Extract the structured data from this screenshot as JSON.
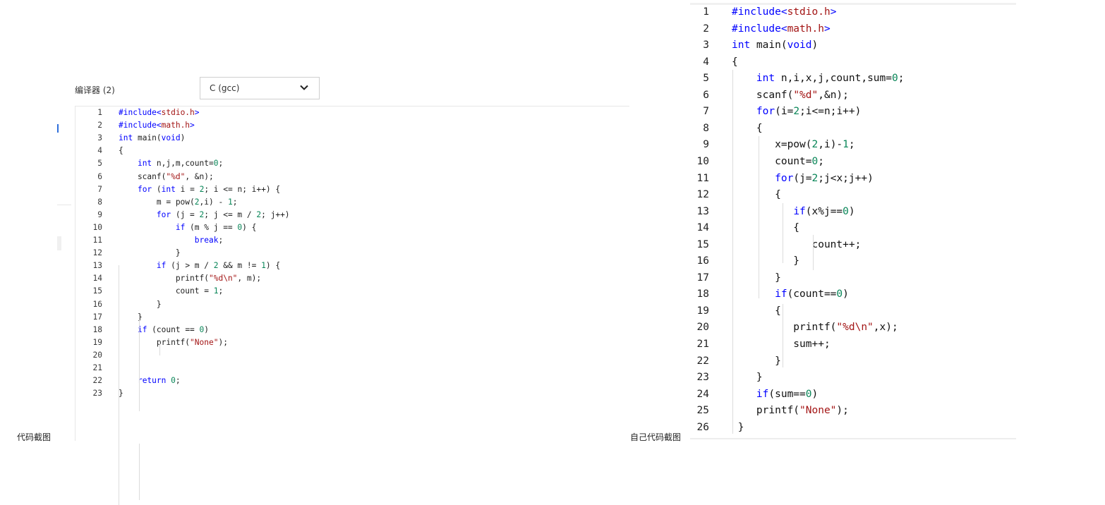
{
  "left": {
    "compiler_label": "编译器 (2)",
    "compiler_value": "C (gcc)",
    "caption": "代码截图",
    "lines": [
      [
        [
          "p",
          "#include<"
        ],
        [
          "hdr",
          "stdio.h"
        ],
        [
          "p",
          ">"
        ]
      ],
      [
        [
          "p",
          "#include<"
        ],
        [
          "hdr",
          "math.h"
        ],
        [
          "p",
          ">"
        ]
      ],
      [
        [
          "k",
          "int"
        ],
        [
          "t",
          " main("
        ],
        [
          "k",
          "void"
        ],
        [
          "t",
          ")"
        ]
      ],
      [
        [
          "t",
          "{"
        ]
      ],
      [
        [
          "t",
          "    "
        ],
        [
          "k",
          "int"
        ],
        [
          "t",
          " n,j,m,count="
        ],
        [
          "n",
          "0"
        ],
        [
          "t",
          ";"
        ]
      ],
      [
        [
          "t",
          "    scanf("
        ],
        [
          "s",
          "\"%d\""
        ],
        [
          "t",
          ", &n);"
        ]
      ],
      [
        [
          "t",
          "    "
        ],
        [
          "k",
          "for"
        ],
        [
          "t",
          " ("
        ],
        [
          "k",
          "int"
        ],
        [
          "t",
          " i = "
        ],
        [
          "n",
          "2"
        ],
        [
          "t",
          "; i <= n; i++) {"
        ]
      ],
      [
        [
          "t",
          "        m = pow("
        ],
        [
          "n",
          "2"
        ],
        [
          "t",
          ",i) - "
        ],
        [
          "n",
          "1"
        ],
        [
          "t",
          ";"
        ]
      ],
      [
        [
          "t",
          "        "
        ],
        [
          "k",
          "for"
        ],
        [
          "t",
          " (j = "
        ],
        [
          "n",
          "2"
        ],
        [
          "t",
          "; j <= m / "
        ],
        [
          "n",
          "2"
        ],
        [
          "t",
          "; j++)"
        ]
      ],
      [
        [
          "t",
          "            "
        ],
        [
          "k",
          "if"
        ],
        [
          "t",
          " (m % j == "
        ],
        [
          "n",
          "0"
        ],
        [
          "t",
          ") {"
        ]
      ],
      [
        [
          "t",
          "                "
        ],
        [
          "k",
          "break"
        ],
        [
          "t",
          ";"
        ]
      ],
      [
        [
          "t",
          "            }"
        ]
      ],
      [
        [
          "t",
          "        "
        ],
        [
          "k",
          "if"
        ],
        [
          "t",
          " (j > m / "
        ],
        [
          "n",
          "2"
        ],
        [
          "t",
          " && m != "
        ],
        [
          "n",
          "1"
        ],
        [
          "t",
          ") {"
        ]
      ],
      [
        [
          "t",
          "            printf("
        ],
        [
          "s",
          "\"%d\\n\""
        ],
        [
          "t",
          ", m);"
        ]
      ],
      [
        [
          "t",
          "            count = "
        ],
        [
          "n",
          "1"
        ],
        [
          "t",
          ";"
        ]
      ],
      [
        [
          "t",
          "        }"
        ]
      ],
      [
        [
          "t",
          "    }"
        ]
      ],
      [
        [
          "t",
          "    "
        ],
        [
          "k",
          "if"
        ],
        [
          "t",
          " (count == "
        ],
        [
          "n",
          "0"
        ],
        [
          "t",
          ")"
        ]
      ],
      [
        [
          "t",
          "        printf("
        ],
        [
          "s",
          "\"None\""
        ],
        [
          "t",
          ");"
        ]
      ],
      [
        [
          "t",
          ""
        ]
      ],
      [
        [
          "t",
          ""
        ]
      ],
      [
        [
          "t",
          "    "
        ],
        [
          "k",
          "return"
        ],
        [
          "t",
          " "
        ],
        [
          "n",
          "0"
        ],
        [
          "t",
          ";"
        ]
      ],
      [
        [
          "t",
          "}"
        ]
      ]
    ]
  },
  "right": {
    "caption": "自己代码截图",
    "lines": [
      [
        [
          "p",
          "#include<"
        ],
        [
          "hdr",
          "stdio.h"
        ],
        [
          "p",
          ">"
        ]
      ],
      [
        [
          "p",
          "#include<"
        ],
        [
          "hdr",
          "math.h"
        ],
        [
          "p",
          ">"
        ]
      ],
      [
        [
          "k",
          "int"
        ],
        [
          "t",
          " main("
        ],
        [
          "k",
          "void"
        ],
        [
          "t",
          ")"
        ]
      ],
      [
        [
          "t",
          "{"
        ]
      ],
      [
        [
          "t",
          "    "
        ],
        [
          "k",
          "int"
        ],
        [
          "t",
          " n,i,x,j,count,sum="
        ],
        [
          "n",
          "0"
        ],
        [
          "t",
          ";"
        ]
      ],
      [
        [
          "t",
          "    scanf("
        ],
        [
          "s",
          "\"%d\""
        ],
        [
          "t",
          ",&n);"
        ]
      ],
      [
        [
          "t",
          "    "
        ],
        [
          "k",
          "for"
        ],
        [
          "t",
          "(i="
        ],
        [
          "n",
          "2"
        ],
        [
          "t",
          ";i<=n;i++)"
        ]
      ],
      [
        [
          "t",
          "    {"
        ]
      ],
      [
        [
          "t",
          "       x=pow("
        ],
        [
          "n",
          "2"
        ],
        [
          "t",
          ",i)-"
        ],
        [
          "n",
          "1"
        ],
        [
          "t",
          ";"
        ]
      ],
      [
        [
          "t",
          "       count="
        ],
        [
          "n",
          "0"
        ],
        [
          "t",
          ";"
        ]
      ],
      [
        [
          "t",
          "       "
        ],
        [
          "k",
          "for"
        ],
        [
          "t",
          "(j="
        ],
        [
          "n",
          "2"
        ],
        [
          "t",
          ";j<x;j++)"
        ]
      ],
      [
        [
          "t",
          "       {"
        ]
      ],
      [
        [
          "t",
          "          "
        ],
        [
          "k",
          "if"
        ],
        [
          "t",
          "(x%j=="
        ],
        [
          "n",
          "0"
        ],
        [
          "t",
          ")"
        ]
      ],
      [
        [
          "t",
          "          {"
        ]
      ],
      [
        [
          "t",
          "             count++;"
        ]
      ],
      [
        [
          "t",
          "          }"
        ]
      ],
      [
        [
          "t",
          "       }"
        ]
      ],
      [
        [
          "t",
          "       "
        ],
        [
          "k",
          "if"
        ],
        [
          "t",
          "(count=="
        ],
        [
          "n",
          "0"
        ],
        [
          "t",
          ")"
        ]
      ],
      [
        [
          "t",
          "       {"
        ]
      ],
      [
        [
          "t",
          "          printf("
        ],
        [
          "s",
          "\"%d\\n\""
        ],
        [
          "t",
          ",x);"
        ]
      ],
      [
        [
          "t",
          "          sum++;"
        ]
      ],
      [
        [
          "t",
          "       }"
        ]
      ],
      [
        [
          "t",
          "    }"
        ]
      ],
      [
        [
          "t",
          "    "
        ],
        [
          "k",
          "if"
        ],
        [
          "t",
          "(sum=="
        ],
        [
          "n",
          "0"
        ],
        [
          "t",
          ")"
        ]
      ],
      [
        [
          "t",
          "    printf("
        ],
        [
          "s",
          "\"None\""
        ],
        [
          "t",
          ");"
        ]
      ],
      [
        [
          "t",
          " }"
        ]
      ]
    ]
  }
}
